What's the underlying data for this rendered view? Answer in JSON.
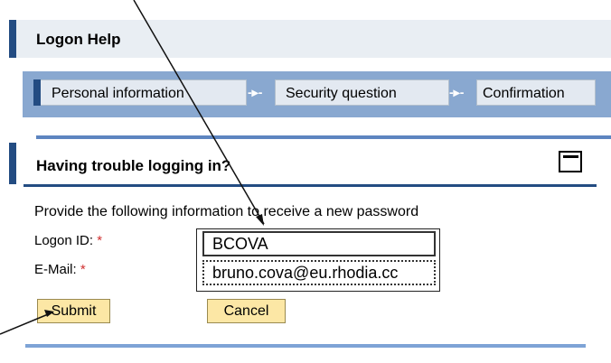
{
  "help_header": {
    "title": "Logon Help"
  },
  "roadmap": {
    "steps": [
      "Personal information",
      "Security question",
      "Confirmation"
    ],
    "arrow": "-▸-"
  },
  "trouble": {
    "title": "Having trouble logging in?",
    "instruction": "Provide the following information to receive a new password"
  },
  "form": {
    "logon_id_label": "Logon ID:",
    "email_label": "E-Mail:",
    "required_mark": "*",
    "logon_id_value": "BCOVA",
    "email_value": "bruno.cova@eu.rhodia.cc"
  },
  "buttons": {
    "submit": "Submit",
    "cancel": "Cancel"
  },
  "colors": {
    "accent": "#234c82",
    "button_bg": "#fce7a5",
    "roadmap_bg": "#89a8d0"
  }
}
